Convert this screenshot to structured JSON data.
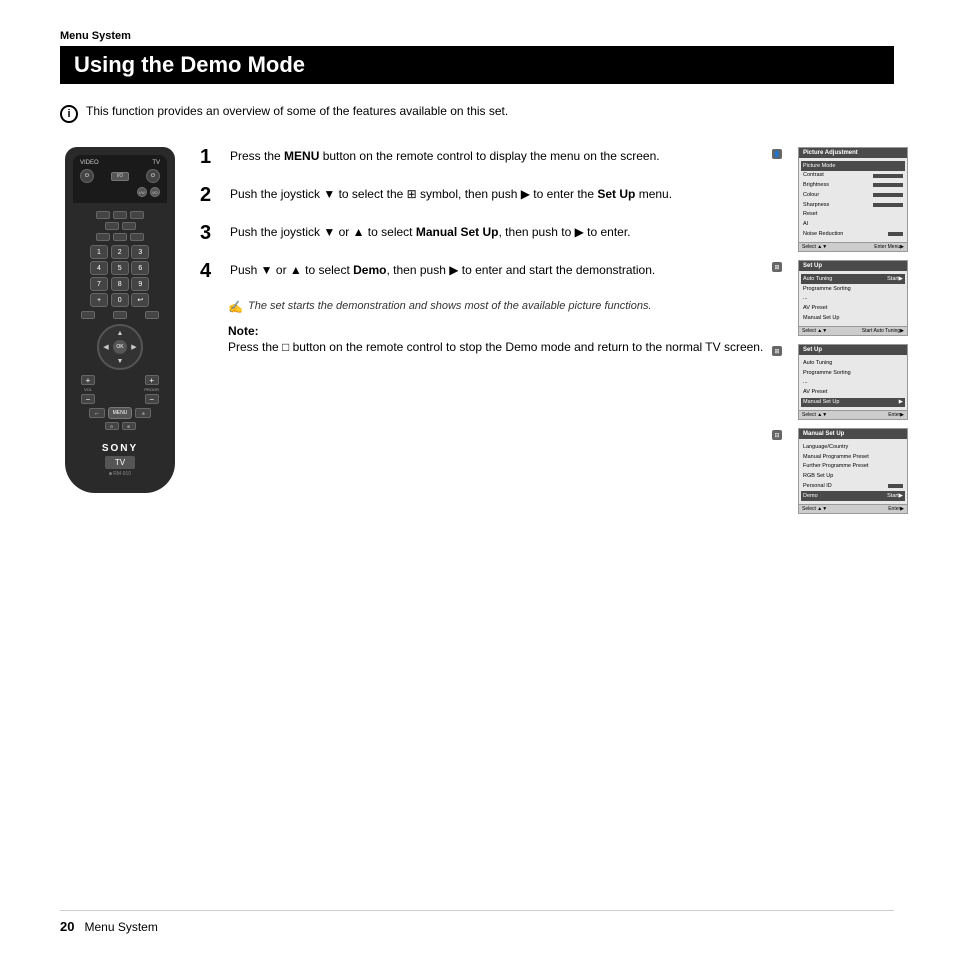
{
  "section_label": "Menu System",
  "page_title": "Using the Demo Mode",
  "intro_text": "This function provides an overview of some of the features available on this set.",
  "steps": [
    {
      "number": "1",
      "text_parts": [
        {
          "text": "Press the ",
          "bold": false
        },
        {
          "text": "MENU",
          "bold": true
        },
        {
          "text": " button on the remote control to display the menu on the screen.",
          "bold": false
        }
      ],
      "text": "Press the MENU button on the remote control to display the menu on the screen."
    },
    {
      "number": "2",
      "text": "Push the joystick ▼ to select the  symbol, then push ▶ to enter the Set Up menu.",
      "bold_words": [
        "Set Up"
      ]
    },
    {
      "number": "3",
      "text": "Push the joystick ▼ or ▲ to select Manual Set Up, then push to ▶ to enter.",
      "bold_words": [
        "Manual Set Up"
      ]
    },
    {
      "number": "4",
      "text": "Push ▼ or ▲ to select Demo, then push ▶ to enter and start the demonstration.",
      "bold_words": [
        "Demo"
      ]
    }
  ],
  "italic_note": "The set starts the demonstration and shows most of the available picture functions.",
  "note_label": "Note:",
  "note_text": "Press the  button on the remote control to stop the Demo mode and return to the normal TV screen.",
  "screens": [
    {
      "header": "Picture Adjustment",
      "rows": [
        {
          "label": "Picture Mode",
          "value": "bar",
          "selected": true
        },
        {
          "label": "Contrast",
          "value": "bar"
        },
        {
          "label": "Brightness",
          "value": "bar"
        },
        {
          "label": "Colour",
          "value": "bar"
        },
        {
          "label": "Sharpness",
          "value": "bar"
        },
        {
          "label": "Reset",
          "value": ""
        },
        {
          "label": "AI",
          "value": ""
        },
        {
          "label": "Noise Reduction",
          "value": "bar"
        }
      ],
      "footer": "Select ▲▼ Enter Menu▶"
    },
    {
      "header": "Set Up",
      "rows": [
        {
          "label": "Auto Tuning",
          "value": "Start▶",
          "selected": true
        },
        {
          "label": "Programme Sorting",
          "value": ""
        },
        {
          "label": "...",
          "value": ""
        },
        {
          "label": "AV Preset",
          "value": ""
        },
        {
          "label": "Manual Set Up",
          "value": ""
        }
      ],
      "footer": "Select ▲▼ Start Auto Tuning▶"
    },
    {
      "header": "Set Up",
      "rows": [
        {
          "label": "Auto Tuning",
          "value": ""
        },
        {
          "label": "Programme Sorting",
          "value": ""
        },
        {
          "label": "...",
          "value": ""
        },
        {
          "label": "AV Preset",
          "value": ""
        },
        {
          "label": "Manual Set Up",
          "value": "",
          "selected": true
        }
      ],
      "footer": "Select ▲▼ Enter▶"
    },
    {
      "header": "Manual Set Up",
      "rows": [
        {
          "label": "Language/Country",
          "value": ""
        },
        {
          "label": "Manual Programme Preset",
          "value": ""
        },
        {
          "label": "Further Programme Preset",
          "value": ""
        },
        {
          "label": "RGB Set Up",
          "value": ""
        },
        {
          "label": "Personal ID",
          "value": "bar"
        },
        {
          "label": "Demo",
          "value": "Start▶",
          "selected": true
        }
      ],
      "footer": "Select ▲▼ Enter▶"
    }
  ],
  "remote": {
    "labels": [
      "VIDEO",
      "TV"
    ],
    "brand": "SONY",
    "tv_label": "TV",
    "model": "RM-910"
  },
  "footer": {
    "page_number": "20",
    "section": "Menu System"
  }
}
